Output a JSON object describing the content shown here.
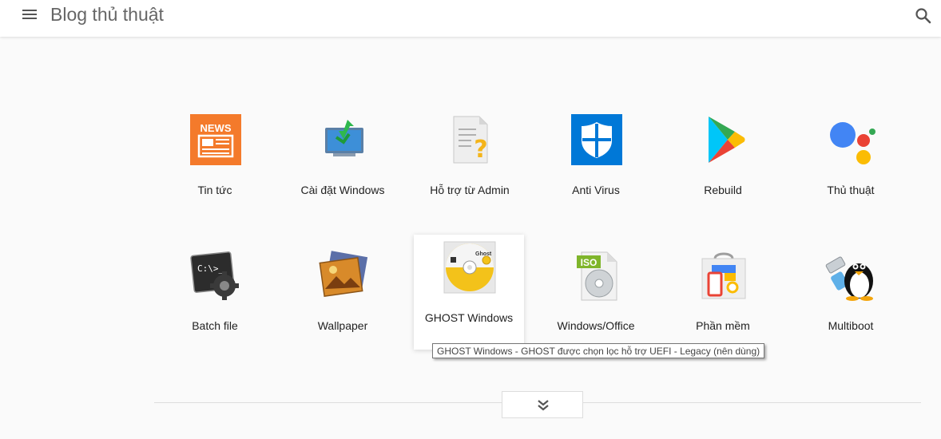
{
  "header": {
    "title": "Blog thủ thuật"
  },
  "tiles": [
    {
      "label": "Tin tức",
      "icon": "news-icon"
    },
    {
      "label": "Cài đặt Windows",
      "icon": "monitor-download-icon"
    },
    {
      "label": "Hỗ trợ từ Admin",
      "icon": "document-question-icon"
    },
    {
      "label": "Anti Virus",
      "icon": "shield-icon"
    },
    {
      "label": "Rebuild",
      "icon": "play-triangle-icon"
    },
    {
      "label": "Thủ thuật",
      "icon": "dots-assistant-icon"
    },
    {
      "label": "Batch file",
      "icon": "terminal-gear-icon"
    },
    {
      "label": "Wallpaper",
      "icon": "image-icon"
    },
    {
      "label": "GHOST Windows",
      "icon": "ghost-cd-icon"
    },
    {
      "label": "Windows/Office",
      "icon": "iso-disc-icon"
    },
    {
      "label": "Phần mềm",
      "icon": "store-bag-icon"
    },
    {
      "label": "Multiboot",
      "icon": "penguin-usb-icon"
    }
  ],
  "tooltip": {
    "text": "GHOST Windows - GHOST được chọn lọc hỗ trợ UEFI - Legacy (nên dùng)"
  },
  "load_more": {
    "icon": "double-chevron-down-icon"
  },
  "colors": {
    "news": "#f47a2b",
    "shield": "#0078d7",
    "accent_text": "#222222"
  }
}
